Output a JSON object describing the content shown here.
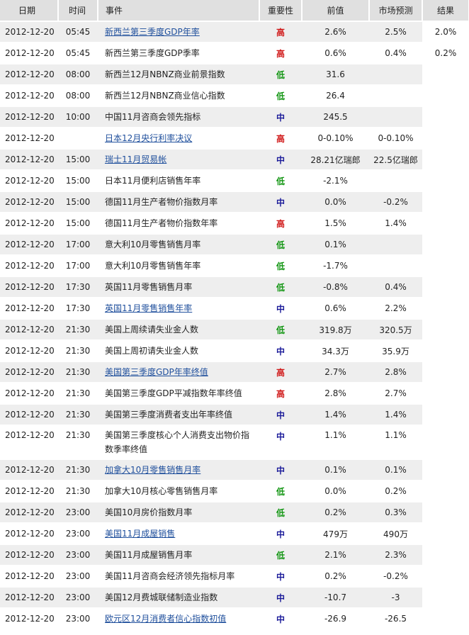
{
  "header": {
    "date": "日期",
    "time": "时间",
    "event": "事件",
    "importance": "重要性",
    "previous": "前值",
    "forecast": "市场预测",
    "result": "结果"
  },
  "colors": {
    "high": "#d01818",
    "low": "#119511",
    "mid": "#1a1a99",
    "link": "#1f4f9c",
    "row_shade": "#eeeeee",
    "header_bg": "#e0e0e0"
  },
  "rows": [
    {
      "date": "2012-12-20",
      "time": "05:45",
      "event": "新西兰第三季度GDP年率",
      "link": true,
      "imp": "高",
      "level": "high",
      "prev": "2.6%",
      "forecast": "2.5%",
      "result": "2.0%"
    },
    {
      "date": "2012-12-20",
      "time": "05:45",
      "event": "新西兰第三季度GDP季率",
      "link": false,
      "imp": "高",
      "level": "high",
      "prev": "0.6%",
      "forecast": "0.4%",
      "result": "0.2%"
    },
    {
      "date": "2012-12-20",
      "time": "08:00",
      "event": "新西兰12月NBNZ商业前景指数",
      "link": false,
      "imp": "低",
      "level": "low",
      "prev": "31.6",
      "forecast": "",
      "result": ""
    },
    {
      "date": "2012-12-20",
      "time": "08:00",
      "event": "新西兰12月NBNZ商业信心指数",
      "link": false,
      "imp": "低",
      "level": "low",
      "prev": "26.4",
      "forecast": "",
      "result": ""
    },
    {
      "date": "2012-12-20",
      "time": "10:00",
      "event": "中国11月咨商会领先指标",
      "link": false,
      "imp": "中",
      "level": "mid",
      "prev": "245.5",
      "forecast": "",
      "result": ""
    },
    {
      "date": "2012-12-20",
      "time": "",
      "event": "日本12月央行利率决议",
      "link": true,
      "imp": "高",
      "level": "high",
      "prev": "0-0.10%",
      "forecast": "0-0.10%",
      "result": ""
    },
    {
      "date": "2012-12-20",
      "time": "15:00",
      "event": "瑞士11月贸易帐",
      "link": true,
      "imp": "中",
      "level": "mid",
      "prev": "28.21亿瑞郎",
      "forecast": "22.5亿瑞郎",
      "result": ""
    },
    {
      "date": "2012-12-20",
      "time": "15:00",
      "event": "日本11月便利店销售年率",
      "link": false,
      "imp": "低",
      "level": "low",
      "prev": "-2.1%",
      "forecast": "",
      "result": ""
    },
    {
      "date": "2012-12-20",
      "time": "15:00",
      "event": "德国11月生产者物价指数月率",
      "link": false,
      "imp": "中",
      "level": "mid",
      "prev": "0.0%",
      "forecast": "-0.2%",
      "result": ""
    },
    {
      "date": "2012-12-20",
      "time": "15:00",
      "event": "德国11月生产者物价指数年率",
      "link": false,
      "imp": "高",
      "level": "high",
      "prev": "1.5%",
      "forecast": "1.4%",
      "result": ""
    },
    {
      "date": "2012-12-20",
      "time": "17:00",
      "event": "意大利10月零售销售月率",
      "link": false,
      "imp": "低",
      "level": "low",
      "prev": "0.1%",
      "forecast": "",
      "result": ""
    },
    {
      "date": "2012-12-20",
      "time": "17:00",
      "event": "意大利10月零售销售年率",
      "link": false,
      "imp": "低",
      "level": "low",
      "prev": "-1.7%",
      "forecast": "",
      "result": ""
    },
    {
      "date": "2012-12-20",
      "time": "17:30",
      "event": "英国11月零售销售月率",
      "link": false,
      "imp": "低",
      "level": "low",
      "prev": "-0.8%",
      "forecast": "0.4%",
      "result": ""
    },
    {
      "date": "2012-12-20",
      "time": "17:30",
      "event": "英国11月零售销售年率",
      "link": true,
      "imp": "中",
      "level": "mid",
      "prev": "0.6%",
      "forecast": "2.2%",
      "result": ""
    },
    {
      "date": "2012-12-20",
      "time": "21:30",
      "event": "美国上周续请失业金人数",
      "link": false,
      "imp": "低",
      "level": "low",
      "prev": "319.8万",
      "forecast": "320.5万",
      "result": ""
    },
    {
      "date": "2012-12-20",
      "time": "21:30",
      "event": "美国上周初请失业金人数",
      "link": false,
      "imp": "中",
      "level": "mid",
      "prev": "34.3万",
      "forecast": "35.9万",
      "result": ""
    },
    {
      "date": "2012-12-20",
      "time": "21:30",
      "event": "美国第三季度GDP年率终值",
      "link": true,
      "imp": "高",
      "level": "high",
      "prev": "2.7%",
      "forecast": "2.8%",
      "result": ""
    },
    {
      "date": "2012-12-20",
      "time": "21:30",
      "event": "美国第三季度GDP平减指数年率终值",
      "link": false,
      "imp": "高",
      "level": "high",
      "prev": "2.8%",
      "forecast": "2.7%",
      "result": ""
    },
    {
      "date": "2012-12-20",
      "time": "21:30",
      "event": "美国第三季度消费者支出年率终值",
      "link": false,
      "imp": "中",
      "level": "mid",
      "prev": "1.4%",
      "forecast": "1.4%",
      "result": ""
    },
    {
      "date": "2012-12-20",
      "time": "21:30",
      "event": "美国第三季度核心个人消费支出物价指数季率终值",
      "link": false,
      "imp": "中",
      "level": "mid",
      "prev": "1.1%",
      "forecast": "1.1%",
      "result": "",
      "tall": true
    },
    {
      "date": "2012-12-20",
      "time": "21:30",
      "event": "加拿大10月零售销售月率",
      "link": true,
      "imp": "中",
      "level": "mid",
      "prev": "0.1%",
      "forecast": "0.1%",
      "result": ""
    },
    {
      "date": "2012-12-20",
      "time": "21:30",
      "event": "加拿大10月核心零售销售月率",
      "link": false,
      "imp": "低",
      "level": "low",
      "prev": "0.0%",
      "forecast": "0.2%",
      "result": ""
    },
    {
      "date": "2012-12-20",
      "time": "23:00",
      "event": "美国10月房价指数月率",
      "link": false,
      "imp": "低",
      "level": "low",
      "prev": "0.2%",
      "forecast": "0.3%",
      "result": ""
    },
    {
      "date": "2012-12-20",
      "time": "23:00",
      "event": "美国11月成屋销售",
      "link": true,
      "imp": "中",
      "level": "mid",
      "prev": "479万",
      "forecast": "490万",
      "result": ""
    },
    {
      "date": "2012-12-20",
      "time": "23:00",
      "event": "美国11月成屋销售月率",
      "link": false,
      "imp": "低",
      "level": "low",
      "prev": "2.1%",
      "forecast": "2.3%",
      "result": ""
    },
    {
      "date": "2012-12-20",
      "time": "23:00",
      "event": "美国11月咨商会经济领先指标月率",
      "link": false,
      "imp": "中",
      "level": "mid",
      "prev": "0.2%",
      "forecast": "-0.2%",
      "result": ""
    },
    {
      "date": "2012-12-20",
      "time": "23:00",
      "event": "美国12月费城联储制造业指数",
      "link": false,
      "imp": "中",
      "level": "mid",
      "prev": "-10.7",
      "forecast": "-3",
      "result": ""
    },
    {
      "date": "2012-12-20",
      "time": "23:00",
      "event": "欧元区12月消费者信心指数初值",
      "link": true,
      "imp": "中",
      "level": "mid",
      "prev": "-26.9",
      "forecast": "-26.5",
      "result": ""
    }
  ]
}
